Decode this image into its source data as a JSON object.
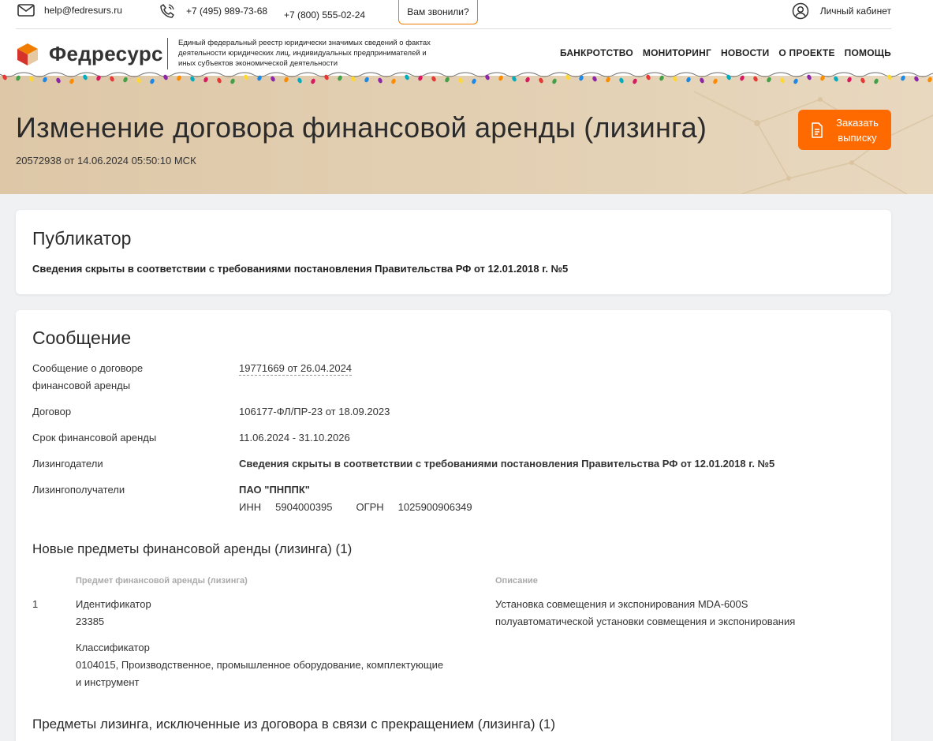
{
  "topbar": {
    "email": "help@fedresurs.ru",
    "phone1": "+7 (495) 989-73-68",
    "phone2": "+7 (800) 555-02-24",
    "called_button": "Вам звонили?",
    "cabinet": "Личный кабинет"
  },
  "header": {
    "logo_text": "Федресурс",
    "tagline": "Единый федеральный реестр юридически значимых сведений о фактах деятельности юридических лиц, индивидуальных предпринимателей и иных субъектов экономической деятельности",
    "nav": [
      "БАНКРОТСТВО",
      "МОНИТОРИНГ",
      "НОВОСТИ",
      "О ПРОЕКТЕ",
      "ПОМОЩЬ"
    ]
  },
  "hero": {
    "title": "Изменение договора финансовой аренды (лизинга)",
    "subtitle": "20572938 от 14.06.2024 05:50:10 МСК",
    "order_button": "Заказать выписку"
  },
  "publisher": {
    "title": "Публикатор",
    "note": "Сведения скрыты в соответствии с требованиями постановления Правительства РФ от 12.01.2018 г. №5"
  },
  "message": {
    "title": "Сообщение",
    "rows": [
      {
        "label": "Сообщение о договоре финансовой аренды",
        "value": "19771669 от 26.04.2024"
      },
      {
        "label": "Договор",
        "value": "106177-ФЛ/ПР-23 от 18.09.2023"
      },
      {
        "label": "Срок финансовой аренды",
        "value": "11.06.2024 - 31.10.2026"
      },
      {
        "label": "Лизингодатели",
        "value": "Сведения скрыты в соответствии с требованиями постановления Правительства РФ от 12.01.2018 г. №5"
      },
      {
        "label": "Лизингополучатели",
        "value": "ПАО \"ПНППК\""
      }
    ],
    "lessee": {
      "inn_label": "ИНН",
      "inn": "5904000395",
      "ogrn_label": "ОГРН",
      "ogrn": "1025900906349"
    },
    "new_items_title": "Новые предметы финансовой аренды (лизинга) (1)",
    "table": {
      "col_subject": "Предмет финансовой аренды (лизинга)",
      "col_description": "Описание",
      "rows": [
        {
          "num": "1",
          "id_label": "Идентификатор",
          "id_value": "23385",
          "class_label": "Классификатор",
          "class_value_1": "0104015, Производственное, промышленное оборудование, комплектующие",
          "class_value_2": "и инструмент",
          "desc_1": "Установка совмещения и экспонирования MDA-600S",
          "desc_2": "полуавтоматической установки совмещения и экспонирования"
        }
      ]
    },
    "excluded_title": "Предметы лизинга, исключенные из договора в связи с прекращением (лизинга) (1)"
  }
}
